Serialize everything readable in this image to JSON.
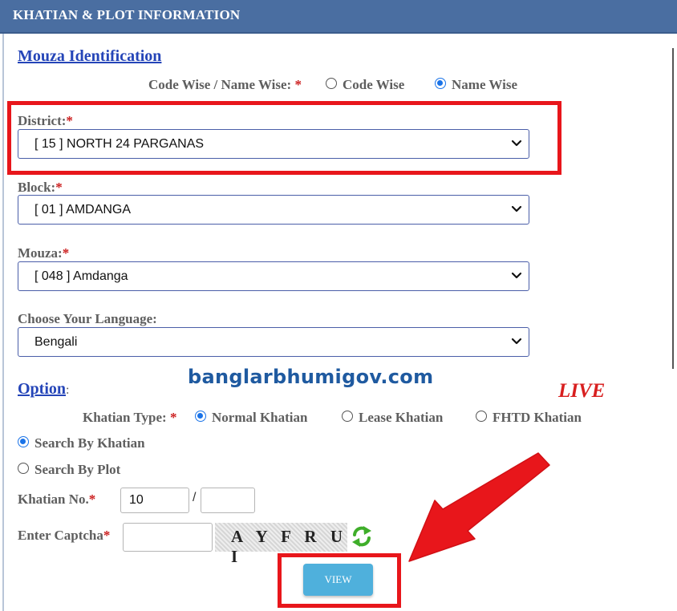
{
  "header": {
    "title": "KHATIAN & PLOT INFORMATION"
  },
  "mouza": {
    "heading": "Mouza Identification",
    "mode_label": "Code Wise / Name Wise:",
    "required_mark": "*",
    "mode_options": [
      "Code Wise",
      "Name Wise"
    ],
    "mode_selected": "Name Wise",
    "district_label": "District:",
    "district_value": "[ 15 ] NORTH 24 PARGANAS",
    "block_label": "Block:",
    "block_value": "[ 01 ] AMDANGA",
    "mouza_label": "Mouza:",
    "mouza_value": "[ 048 ] Amdanga",
    "language_label": "Choose Your Language:",
    "language_value": "Bengali"
  },
  "option": {
    "heading": "Option",
    "colon": ":",
    "khatian_type_label": "Khatian Type:",
    "khatian_types": [
      "Normal Khatian",
      "Lease Khatian",
      "FHTD Khatian"
    ],
    "khatian_type_selected": "Normal Khatian",
    "search_modes": [
      "Search By Khatian",
      "Search By Plot"
    ],
    "search_mode_selected": "Search By Khatian",
    "khatian_no_label": "Khatian No.",
    "khatian_no_value": "10",
    "khatian_no_sep": "/",
    "khatian_no_suffix": "",
    "captcha_label": "Enter Captcha",
    "captcha_value": "",
    "captcha_text": "A Y F R U I",
    "view_button": "VIEW"
  },
  "overlay": {
    "watermark": "banglarbhumigov.com",
    "live_text": "LIVE",
    "highlight_color": "#e8161b",
    "arrow_color": "#e8161b"
  },
  "icons": {
    "dropdown": "chevron-down-icon",
    "refresh": "refresh-icon"
  }
}
